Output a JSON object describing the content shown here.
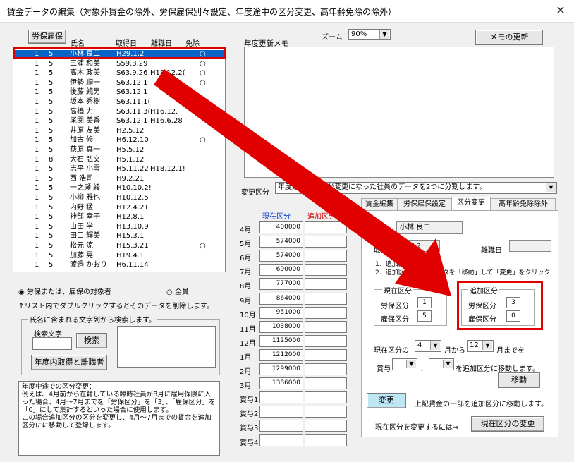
{
  "window": {
    "title": "賃金データの編集（対象外賃金の除外、労保雇保別々設定、年度途中の区分変更、高年齢免除の除外）",
    "close": "✕"
  },
  "list_header": {
    "button": "労保雇保",
    "name": "氏名",
    "acquired": "取得日",
    "left": "離職日",
    "exempt": "免除"
  },
  "employees": [
    {
      "a": "1",
      "b": "5",
      "name": "小林 良二",
      "acq": "H29.1.2",
      "left": "",
      "ex": "○",
      "selected": true
    },
    {
      "a": "1",
      "b": "5",
      "name": "三浦 和美",
      "acq": "S59.3.29",
      "left": "",
      "ex": "○"
    },
    {
      "a": "1",
      "b": "5",
      "name": "高木 政美",
      "acq": "S63.9.26",
      "left": "H18.12.2(",
      "ex": "○"
    },
    {
      "a": "1",
      "b": "5",
      "name": "伊勢 順一",
      "acq": "S63.12.1",
      "left": "",
      "ex": "○"
    },
    {
      "a": "1",
      "b": "5",
      "name": "後藤 純男",
      "acq": "S63.12.1",
      "left": "",
      "ex": ""
    },
    {
      "a": "1",
      "b": "5",
      "name": "坂本 秀樹",
      "acq": "S63.11.1(",
      "left": "",
      "ex": ""
    },
    {
      "a": "1",
      "b": "5",
      "name": "高橋 力",
      "acq": "S63.11.3(",
      "left": "H16.12.",
      "ex": ""
    },
    {
      "a": "1",
      "b": "5",
      "name": "尾関 美香",
      "acq": "S63.12.1",
      "left": "H16.6.28",
      "ex": ""
    },
    {
      "a": "1",
      "b": "5",
      "name": "井原 友美",
      "acq": "H2.5.12",
      "left": "",
      "ex": ""
    },
    {
      "a": "1",
      "b": "5",
      "name": "加古 修",
      "acq": "H6.12.10",
      "left": "",
      "ex": "○"
    },
    {
      "a": "1",
      "b": "5",
      "name": "荻原 真一",
      "acq": "H5.5.12",
      "left": "",
      "ex": ""
    },
    {
      "a": "1",
      "b": "8",
      "name": "大石 弘文",
      "acq": "H5.1.12",
      "left": "",
      "ex": ""
    },
    {
      "a": "1",
      "b": "5",
      "name": "志平 小雪",
      "acq": "H5.11.22",
      "left": "H18.12.1!",
      "ex": ""
    },
    {
      "a": "1",
      "b": "5",
      "name": "西 浩司",
      "acq": "H9.2.21",
      "left": "",
      "ex": ""
    },
    {
      "a": "1",
      "b": "5",
      "name": "一之瀬 綾",
      "acq": "H10.10.2!",
      "left": "",
      "ex": ""
    },
    {
      "a": "1",
      "b": "5",
      "name": "小柳 雅也",
      "acq": "H10.12.5",
      "left": "",
      "ex": ""
    },
    {
      "a": "1",
      "b": "5",
      "name": "内野 猛",
      "acq": "H12.4.21",
      "left": "",
      "ex": ""
    },
    {
      "a": "1",
      "b": "5",
      "name": "神部 幸子",
      "acq": "H12.8.1",
      "left": "",
      "ex": ""
    },
    {
      "a": "1",
      "b": "5",
      "name": "山田 学",
      "acq": "H13.10.9",
      "left": "",
      "ex": ""
    },
    {
      "a": "1",
      "b": "5",
      "name": "田口 輝美",
      "acq": "H15.3.1",
      "left": "",
      "ex": ""
    },
    {
      "a": "1",
      "b": "5",
      "name": "松元 涼",
      "acq": "H15.3.21",
      "left": "",
      "ex": "○"
    },
    {
      "a": "1",
      "b": "5",
      "name": "加藤 晃",
      "acq": "H19.4.1",
      "left": "",
      "ex": ""
    },
    {
      "a": "1",
      "b": "5",
      "name": "渡邉 かおり",
      "acq": "H6.11.14",
      "left": "",
      "ex": ""
    }
  ],
  "radio": {
    "opt1": "労保または、雇保の対象者",
    "opt2": "全員"
  },
  "hint": "↑リスト内でダブルクリックするとそのデータを削除します。",
  "search": {
    "legend": "氏名に含まれる文字列から検索します。",
    "label": "検索文字",
    "button": "検索",
    "year_button": "年度内取得と離職者"
  },
  "note": "年度中途での区分変更：\n例えば、4月前から在籍している臨時社員が8月に雇用保険に入った場合、4月～7月までを「労保区分」を「3」、「雇保区分」を「0」にして集計するといった場合に使用します。\nこの場合追加区分の区分を変更し、4月～7月までの賃金を追加区分にに移動して登録します。",
  "memo": {
    "label": "年度更新メモ",
    "zoom_label": "ズーム",
    "zoom": "90%",
    "update_button": "メモの更新"
  },
  "change": {
    "label": "変更区分",
    "value": "年度途中で区分が変更になった社員のデータを2つに分割します。"
  },
  "months_header": {
    "current": "現在区分",
    "added": "追加区分"
  },
  "months": [
    {
      "m": "4月",
      "v": "400000"
    },
    {
      "m": "5月",
      "v": "574000"
    },
    {
      "m": "6月",
      "v": "574000"
    },
    {
      "m": "7月",
      "v": "690000"
    },
    {
      "m": "8月",
      "v": "777000"
    },
    {
      "m": "9月",
      "v": "864000"
    },
    {
      "m": "10月",
      "v": "951000"
    },
    {
      "m": "11月",
      "v": "1038000"
    },
    {
      "m": "12月",
      "v": "1125000"
    },
    {
      "m": "1月",
      "v": "1212000"
    },
    {
      "m": "2月",
      "v": "1299000"
    },
    {
      "m": "3月",
      "v": "1386000"
    },
    {
      "m": "賞与1",
      "v": ""
    },
    {
      "m": "賞与2",
      "v": ""
    },
    {
      "m": "賞与3",
      "v": ""
    },
    {
      "m": "賞与4",
      "v": ""
    }
  ],
  "tabs": [
    "賃金編集",
    "労保雇保設定",
    "区分変更",
    "高年齢免除除外"
  ],
  "panel": {
    "name_label": "氏名",
    "name": "小林 良二",
    "acq_label": "取得日",
    "acq": "H29.1.2",
    "left_label": "離職日",
    "left": "",
    "step1": "1．追加区分を設定して",
    "step2": "2．追加区分に一部データを「移動」して「変更」をクリック",
    "current": {
      "legend": "現在区分",
      "rou_label": "労保区分",
      "rou": "1",
      "koyo_label": "雇保区分",
      "koyo": "5"
    },
    "added": {
      "legend": "追加区分",
      "rou_label": "労保区分",
      "rou": "3",
      "koyo_label": "雇保区分",
      "koyo": "0"
    },
    "range": {
      "prefix": "現在区分の",
      "from": "4",
      "mid": "月から",
      "to": "12",
      "suffix": "月までを"
    },
    "bonus": {
      "label": "賞与",
      "sep": "、",
      "suffix": "を追加区分に移動します。"
    },
    "move_button": "移動",
    "change_button": "変更",
    "change_text": "上記賃金の一部を追加区分に移動します。",
    "current_change_text": "現在区分を変更するには⇒",
    "current_change_button": "現在区分の変更"
  },
  "colors": {
    "selection": "#0a64c8",
    "highlight": "#e00000",
    "accent_blue": "#0033cc",
    "accent_red": "#d00000",
    "change_button": "#bfe6f5"
  }
}
